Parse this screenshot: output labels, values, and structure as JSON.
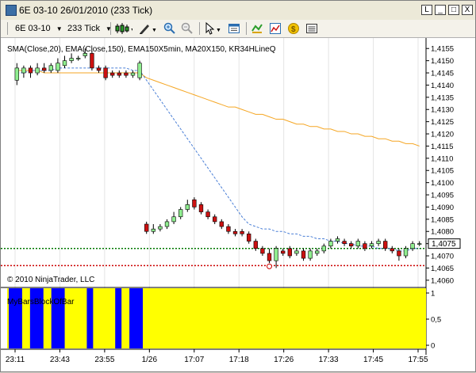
{
  "window": {
    "title": "6E 03-10  26/01/2010 (233 Tick)",
    "buttons": [
      "L",
      "_",
      "□",
      "X"
    ]
  },
  "toolbar": {
    "instrument": "6E 03-10",
    "interval": "233 Tick",
    "icons": [
      "candlestick-icon",
      "pencil-icon",
      "zoom-in-icon",
      "zoom-out-icon",
      "cursor-icon",
      "properties-icon",
      "strategy-icon",
      "indicators-icon",
      "money-icon",
      "data-box-icon"
    ]
  },
  "chart": {
    "indicator_label": "SMA(Close,20), EMA(Close,150), EMA150X5min, MA20X150, KR34HLineQ",
    "copyright": "© 2010 NinjaTrader, LLC",
    "lower_panel_label": "MyBarsBlockOfBar",
    "current_price_label": "1,4075",
    "colors": {
      "up_candle": "#90ee90",
      "down_candle": "#cc1111",
      "ema150": "#f5a623",
      "sma20": "#4a7fd6",
      "green_line": "#007700",
      "red_line": "#cc0000",
      "panel_yellow": "#ffff00",
      "panel_blue": "#0000ff"
    }
  },
  "chart_data": {
    "type": "candlestick",
    "title": "",
    "y_ticks": [
      "1,4155",
      "1,4150",
      "1,4145",
      "1,4140",
      "1,4135",
      "1,4130",
      "1,4125",
      "1,4120",
      "1,4115",
      "1,4110",
      "1,4105",
      "1,4100",
      "1,4095",
      "1,4090",
      "1,4085",
      "1,4080",
      "1,4075",
      "1,4070",
      "1,4065",
      "1,4060"
    ],
    "ylim": [
      1.4058,
      1.4158
    ],
    "x_ticks": [
      "23:11",
      "23:43",
      "23:55",
      "1/26",
      "17:07",
      "17:18",
      "17:26",
      "17:33",
      "17:45",
      "17:55"
    ],
    "candles": [
      {
        "o": 1.4142,
        "c": 1.4147,
        "h": 1.4149,
        "l": 1.414
      },
      {
        "o": 1.4145,
        "c": 1.4147,
        "h": 1.4148,
        "l": 1.4143
      },
      {
        "o": 1.4147,
        "c": 1.4145,
        "h": 1.4148,
        "l": 1.4143
      },
      {
        "o": 1.4145,
        "c": 1.4147,
        "h": 1.4149,
        "l": 1.4144
      },
      {
        "o": 1.4147,
        "c": 1.4146,
        "h": 1.4149,
        "l": 1.4145
      },
      {
        "o": 1.4146,
        "c": 1.4148,
        "h": 1.4149,
        "l": 1.4145
      },
      {
        "o": 1.4146,
        "c": 1.4149,
        "h": 1.4151,
        "l": 1.4145
      },
      {
        "o": 1.4148,
        "c": 1.415,
        "h": 1.4152,
        "l": 1.4147
      },
      {
        "o": 1.415,
        "c": 1.4151,
        "h": 1.4153,
        "l": 1.4149
      },
      {
        "o": 1.4151,
        "c": 1.4151,
        "h": 1.4152,
        "l": 1.415
      },
      {
        "o": 1.4152,
        "c": 1.4153,
        "h": 1.4155,
        "l": 1.4151
      },
      {
        "o": 1.4153,
        "c": 1.4147,
        "h": 1.4154,
        "l": 1.4146
      },
      {
        "o": 1.4147,
        "c": 1.4146,
        "h": 1.4148,
        "l": 1.4145
      },
      {
        "o": 1.4147,
        "c": 1.4143,
        "h": 1.4148,
        "l": 1.4142
      },
      {
        "o": 1.4145,
        "c": 1.4144,
        "h": 1.4146,
        "l": 1.4143
      },
      {
        "o": 1.4145,
        "c": 1.4144,
        "h": 1.4146,
        "l": 1.4143
      },
      {
        "o": 1.4145,
        "c": 1.4144,
        "h": 1.4146,
        "l": 1.4143
      },
      {
        "o": 1.4144,
        "c": 1.4145,
        "h": 1.4146,
        "l": 1.4143
      },
      {
        "o": 1.4143,
        "c": 1.4149,
        "h": 1.415,
        "l": 1.4142
      },
      {
        "o": 1.4083,
        "c": 1.408,
        "h": 1.4084,
        "l": 1.4079
      },
      {
        "o": 1.408,
        "c": 1.4081,
        "h": 1.4083,
        "l": 1.4079
      },
      {
        "o": 1.4081,
        "c": 1.4082,
        "h": 1.4083,
        "l": 1.408
      },
      {
        "o": 1.4082,
        "c": 1.4084,
        "h": 1.4085,
        "l": 1.4081
      },
      {
        "o": 1.4084,
        "c": 1.4086,
        "h": 1.4088,
        "l": 1.4083
      },
      {
        "o": 1.4086,
        "c": 1.4089,
        "h": 1.409,
        "l": 1.4085
      },
      {
        "o": 1.4089,
        "c": 1.4091,
        "h": 1.4093,
        "l": 1.4088
      },
      {
        "o": 1.4093,
        "c": 1.409,
        "h": 1.4094,
        "l": 1.4089
      },
      {
        "o": 1.4091,
        "c": 1.4088,
        "h": 1.4092,
        "l": 1.4087
      },
      {
        "o": 1.4088,
        "c": 1.4086,
        "h": 1.4089,
        "l": 1.4085
      },
      {
        "o": 1.4086,
        "c": 1.4084,
        "h": 1.4087,
        "l": 1.4083
      },
      {
        "o": 1.4084,
        "c": 1.4082,
        "h": 1.4085,
        "l": 1.4081
      },
      {
        "o": 1.4082,
        "c": 1.408,
        "h": 1.4083,
        "l": 1.4079
      },
      {
        "o": 1.408,
        "c": 1.4079,
        "h": 1.4081,
        "l": 1.4078
      },
      {
        "o": 1.408,
        "c": 1.4079,
        "h": 1.4081,
        "l": 1.4078
      },
      {
        "o": 1.4079,
        "c": 1.4076,
        "h": 1.408,
        "l": 1.4075
      },
      {
        "o": 1.4076,
        "c": 1.4073,
        "h": 1.4077,
        "l": 1.4072
      },
      {
        "o": 1.4073,
        "c": 1.4071,
        "h": 1.4074,
        "l": 1.407
      },
      {
        "o": 1.4071,
        "c": 1.4068,
        "h": 1.4073,
        "l": 1.4067
      },
      {
        "o": 1.4068,
        "c": 1.4073,
        "h": 1.4074,
        "l": 1.4065
      },
      {
        "o": 1.4072,
        "c": 1.4071,
        "h": 1.4073,
        "l": 1.407
      },
      {
        "o": 1.4073,
        "c": 1.407,
        "h": 1.4074,
        "l": 1.4069
      },
      {
        "o": 1.4071,
        "c": 1.4072,
        "h": 1.4073,
        "l": 1.407
      },
      {
        "o": 1.4072,
        "c": 1.4069,
        "h": 1.4073,
        "l": 1.4068
      },
      {
        "o": 1.4069,
        "c": 1.4072,
        "h": 1.4073,
        "l": 1.4068
      },
      {
        "o": 1.4071,
        "c": 1.4072,
        "h": 1.4073,
        "l": 1.407
      },
      {
        "o": 1.4072,
        "c": 1.4074,
        "h": 1.4075,
        "l": 1.4071
      },
      {
        "o": 1.4074,
        "c": 1.4076,
        "h": 1.4077,
        "l": 1.4073
      },
      {
        "o": 1.4076,
        "c": 1.4077,
        "h": 1.4078,
        "l": 1.4075
      },
      {
        "o": 1.4076,
        "c": 1.4075,
        "h": 1.4077,
        "l": 1.4074
      },
      {
        "o": 1.4075,
        "c": 1.4074,
        "h": 1.4076,
        "l": 1.4073
      },
      {
        "o": 1.4074,
        "c": 1.4076,
        "h": 1.4077,
        "l": 1.4073
      },
      {
        "o": 1.4075,
        "c": 1.4073,
        "h": 1.4076,
        "l": 1.4072
      },
      {
        "o": 1.4074,
        "c": 1.4075,
        "h": 1.4076,
        "l": 1.4073
      },
      {
        "o": 1.4075,
        "c": 1.4076,
        "h": 1.4077,
        "l": 1.4074
      },
      {
        "o": 1.4076,
        "c": 1.4073,
        "h": 1.4077,
        "l": 1.4072
      },
      {
        "o": 1.4073,
        "c": 1.4072,
        "h": 1.4074,
        "l": 1.4071
      },
      {
        "o": 1.4072,
        "c": 1.407,
        "h": 1.4073,
        "l": 1.4068
      },
      {
        "o": 1.407,
        "c": 1.4073,
        "h": 1.4074,
        "l": 1.4069
      },
      {
        "o": 1.4073,
        "c": 1.4075,
        "h": 1.4076,
        "l": 1.4072
      },
      {
        "o": 1.4075,
        "c": 1.4075,
        "h": 1.4076,
        "l": 1.4074
      }
    ],
    "ema150": [
      1.4146,
      1.4146,
      1.4146,
      1.4146,
      1.4145,
      1.4145,
      1.4145,
      1.4145,
      1.4145,
      1.4145,
      1.4145,
      1.4145,
      1.4145,
      1.4145,
      1.4145,
      1.4145,
      1.4145,
      1.4145,
      1.4145,
      1.4143,
      1.4142,
      1.4141,
      1.414,
      1.4139,
      1.4138,
      1.4137,
      1.4136,
      1.4135,
      1.4134,
      1.4133,
      1.4132,
      1.4131,
      1.4131,
      1.413,
      1.4129,
      1.4128,
      1.4128,
      1.4127,
      1.4126,
      1.4126,
      1.4125,
      1.4124,
      1.4124,
      1.4123,
      1.4123,
      1.4122,
      1.4122,
      1.4121,
      1.4121,
      1.412,
      1.412,
      1.4119,
      1.4119,
      1.4118,
      1.4118,
      1.4117,
      1.4117,
      1.4116,
      1.4116,
      1.4115
    ],
    "sma20": [
      1.4145,
      1.4145,
      1.4146,
      1.4146,
      1.4146,
      1.4146,
      1.4147,
      1.4147,
      1.4147,
      1.4147,
      1.4147,
      1.4147,
      1.4147,
      1.4147,
      1.4147,
      1.4147,
      1.4147,
      1.4146,
      1.4146,
      1.4142,
      1.4138,
      1.4134,
      1.413,
      1.4126,
      1.4122,
      1.4118,
      1.4114,
      1.411,
      1.4106,
      1.4102,
      1.4098,
      1.4094,
      1.409,
      1.4086,
      1.4083,
      1.4082,
      1.4081,
      1.4081,
      1.408,
      1.408,
      1.4079,
      1.4079,
      1.4078,
      1.4078,
      1.4077,
      1.4077,
      1.4076,
      1.4076,
      1.4075,
      1.4075,
      1.4074,
      1.4074,
      1.4074,
      1.4073,
      1.4073,
      1.4073,
      1.4072,
      1.4072,
      1.4073,
      1.4073
    ],
    "green_line": 1.4073,
    "red_line": 1.4066,
    "lower_panel": {
      "y_ticks": [
        "1",
        "0,5",
        "0"
      ],
      "ylim": [
        0,
        1
      ],
      "blue_bars": [
        [
          0,
          1
        ],
        [
          3,
          4
        ],
        [
          6,
          7
        ],
        [
          11,
          11
        ],
        [
          15,
          15
        ],
        [
          17,
          18
        ]
      ]
    }
  }
}
